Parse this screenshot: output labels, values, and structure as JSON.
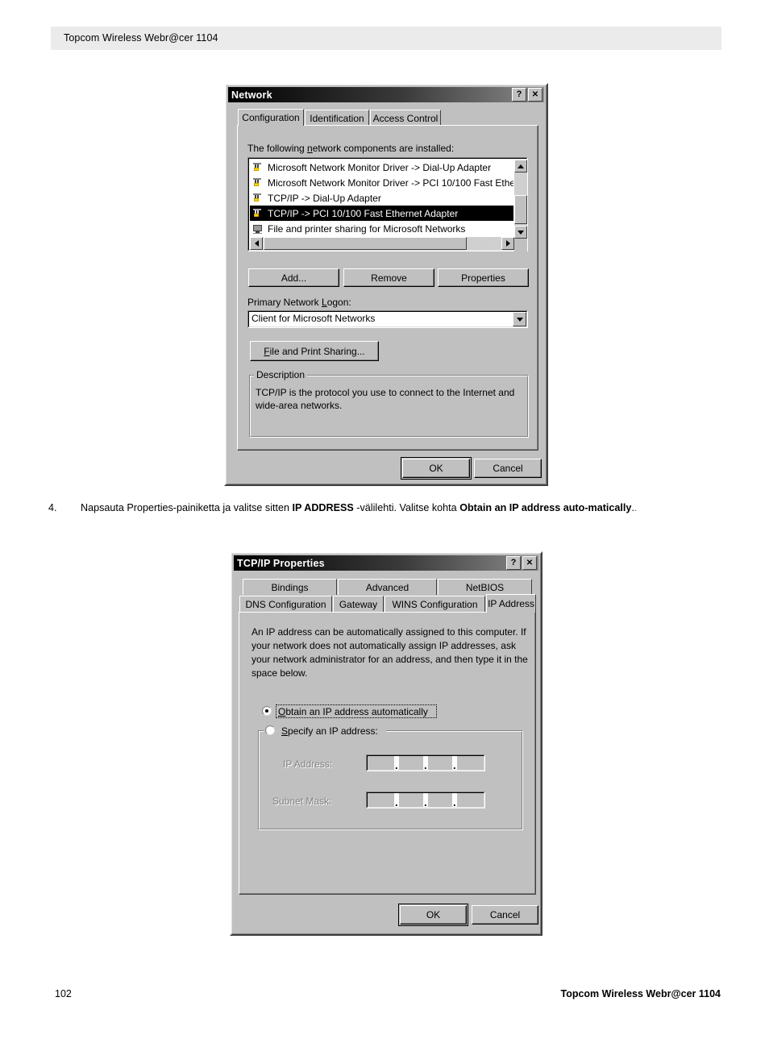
{
  "page": {
    "header_title": "Topcom Wireless Webr@cer 1104",
    "footer_page_number": "102",
    "footer_title": "Topcom Wireless Webr@cer 1104"
  },
  "instruction": {
    "number": "4.",
    "part1": "Napsauta Properties-painiketta ja valitse sitten ",
    "bold1": "IP ADDRESS",
    "part2": " -välilehti. Valitse kohta ",
    "bold2": "Obtain an IP address auto-matically",
    "part3": ".",
    "trailing_dot": "."
  },
  "network_dialog": {
    "title": "Network",
    "help_button": "?",
    "close_button": "✕",
    "tabs": [
      {
        "label": "Configuration",
        "selected": true
      },
      {
        "label": "Identification",
        "selected": false
      },
      {
        "label": "Access Control",
        "selected": false
      }
    ],
    "list_label": "The following network components are installed:",
    "list_items": [
      {
        "text": "Microsoft Network Monitor Driver -> Dial-Up Adapter",
        "icon": "network-protocol-icon",
        "selected": false
      },
      {
        "text": "Microsoft Network Monitor Driver -> PCI 10/100 Fast Ethe",
        "icon": "network-protocol-icon",
        "selected": false
      },
      {
        "text": "TCP/IP -> Dial-Up Adapter",
        "icon": "network-protocol-icon",
        "selected": false
      },
      {
        "text": "TCP/IP -> PCI 10/100 Fast Ethernet Adapter",
        "icon": "network-protocol-icon",
        "selected": true
      },
      {
        "text": "File and printer sharing for Microsoft Networks",
        "icon": "computer-service-icon",
        "selected": false
      }
    ],
    "buttons": {
      "add": "Add...",
      "remove": "Remove",
      "properties": "Properties",
      "file_print_sharing": "File and Print Sharing...",
      "ok": "OK",
      "cancel": "Cancel"
    },
    "primary_logon_label": "Primary Network Logon:",
    "primary_logon_value": "Client for Microsoft Networks",
    "description_group_title": "Description",
    "description_text": "TCP/IP is the protocol you use to connect to the Internet and wide-area networks."
  },
  "tcpip_dialog": {
    "title": "TCP/IP Properties",
    "help_button": "?",
    "close_button": "✕",
    "tabs_row1": [
      {
        "label": "Bindings",
        "selected": false
      },
      {
        "label": "Advanced",
        "selected": false
      },
      {
        "label": "NetBIOS",
        "selected": false
      }
    ],
    "tabs_row2": [
      {
        "label": "DNS Configuration",
        "selected": false
      },
      {
        "label": "Gateway",
        "selected": false
      },
      {
        "label": "WINS Configuration",
        "selected": false
      },
      {
        "label": "IP Address",
        "selected": true
      }
    ],
    "body_text": "An IP address can be automatically assigned to this computer. If your network does not automatically assign IP addresses, ask your network administrator for an address, and then type it in the space below.",
    "radio_obtain": {
      "label": "Obtain an IP address automatically",
      "checked": true
    },
    "radio_specify": {
      "label": "Specify an IP address:",
      "checked": false
    },
    "ip_address_label": "IP Address:",
    "ip_address_value": "   .   .   .   ",
    "subnet_mask_label": "Subnet Mask:",
    "subnet_mask_value": "   .   .   .   ",
    "buttons": {
      "ok": "OK",
      "cancel": "Cancel"
    }
  },
  "colors": {
    "dialog_face": "#c0c0c0",
    "titlebar_active": "#000000",
    "selection": "#000000",
    "header_band": "#ebebeb",
    "accent_green": "#2faa3c"
  }
}
